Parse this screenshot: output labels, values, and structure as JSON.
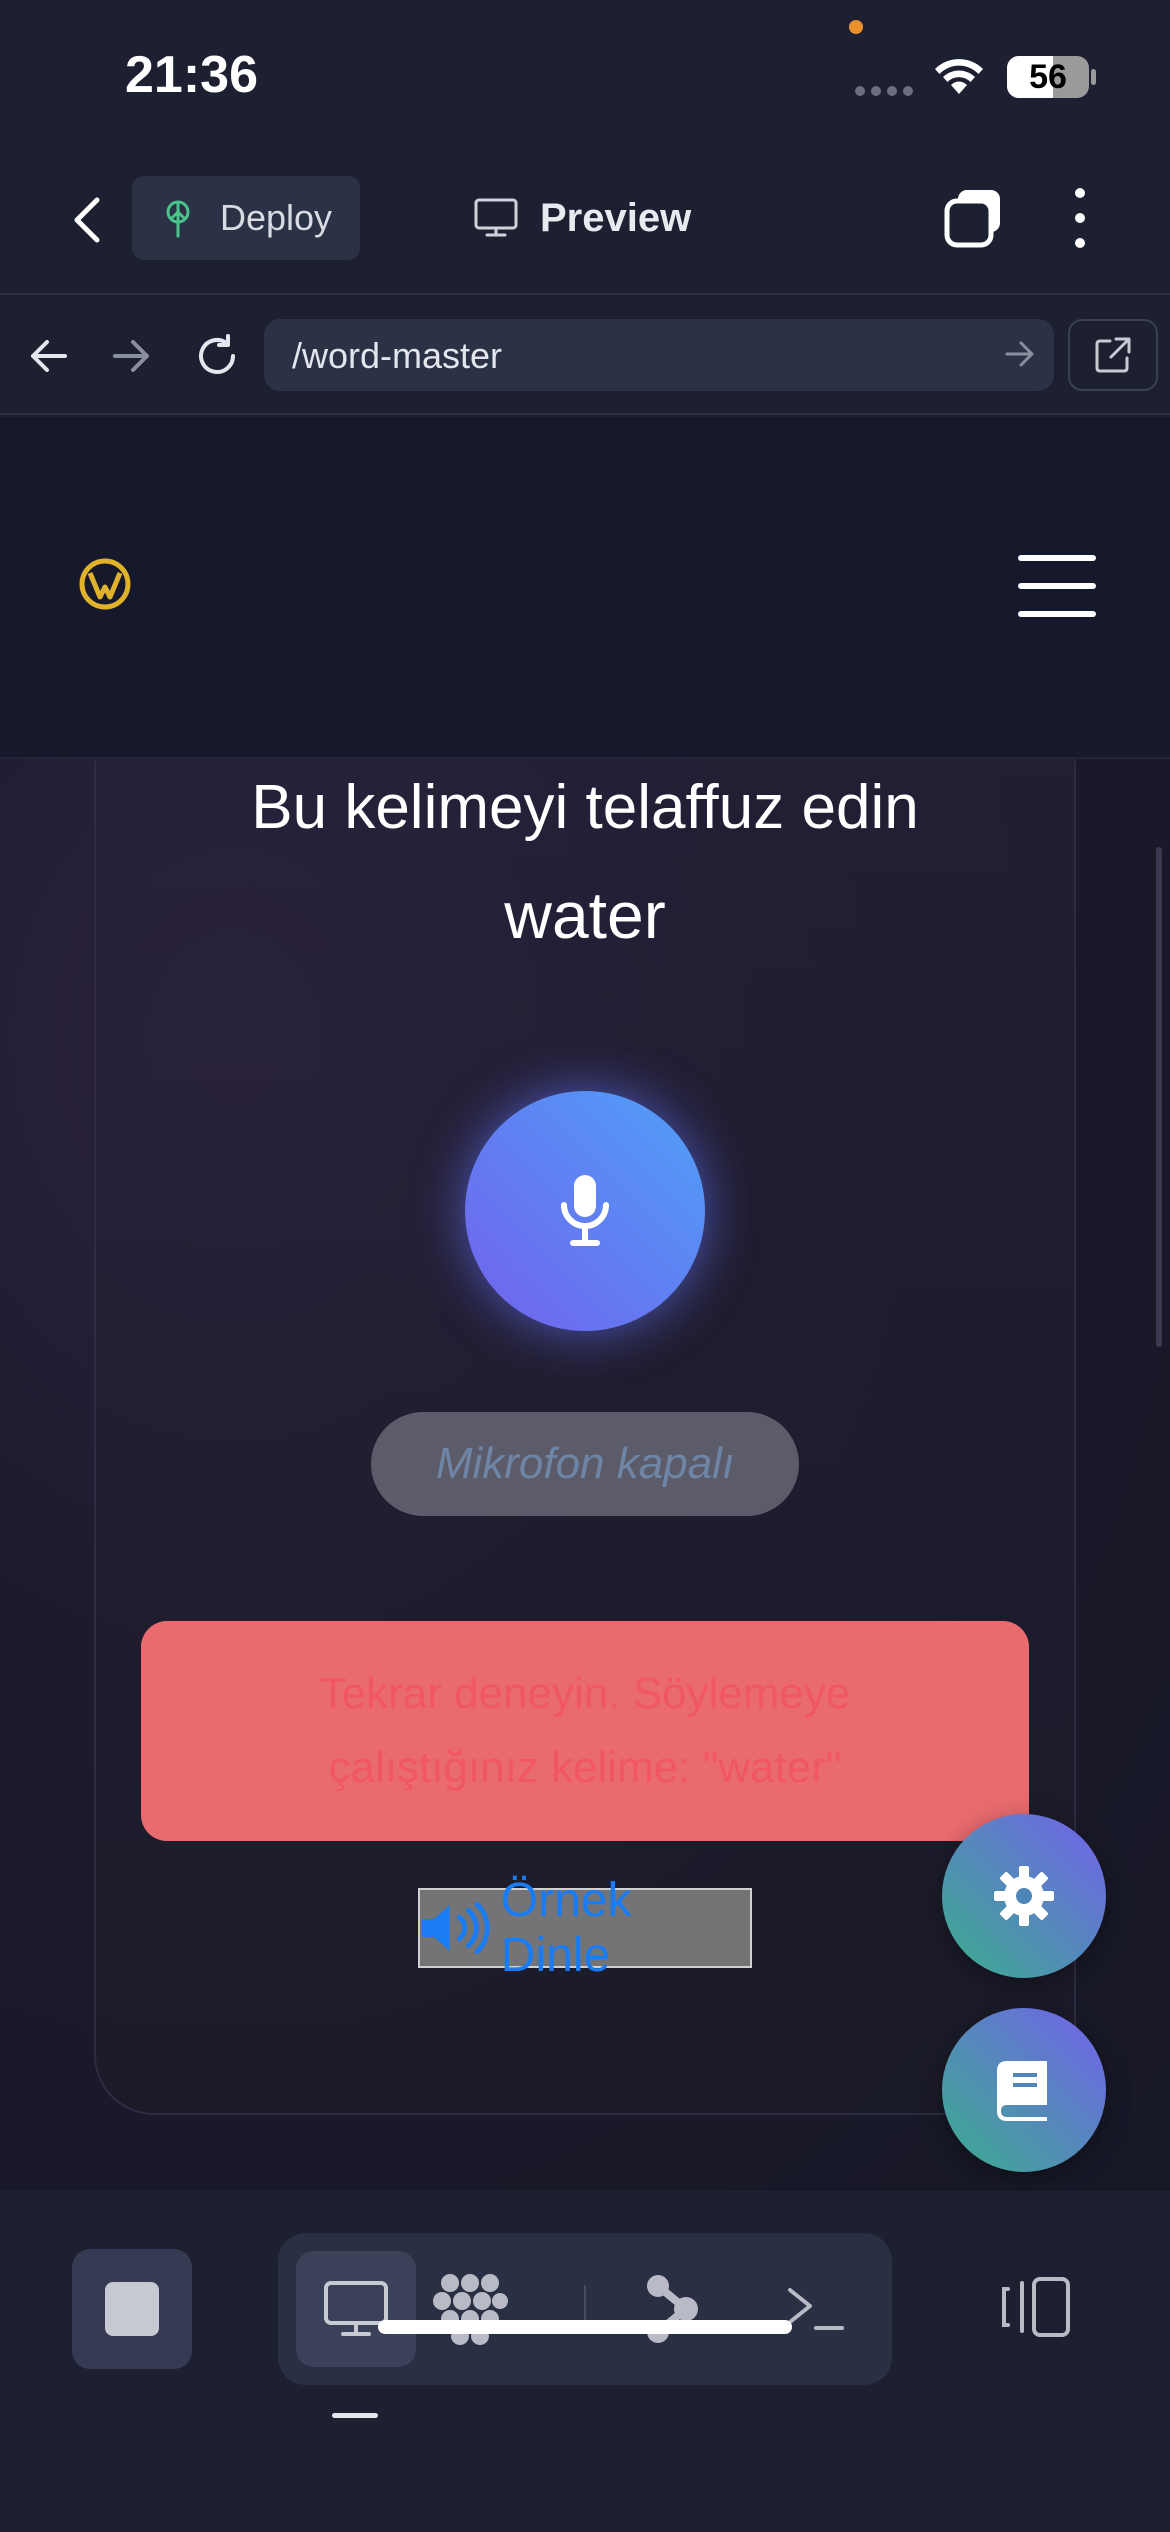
{
  "status": {
    "time": "21:36",
    "battery": "56",
    "battery_level": 0.56
  },
  "toolbar": {
    "deploy_label": "Deploy",
    "preview_label": "Preview"
  },
  "urlbar": {
    "url": "/word-master"
  },
  "content": {
    "prompt": "Bu kelimeyi telaffuz edin",
    "word": "water",
    "mic_status": "Mikrofon kapalı",
    "feedback": "Tekrar deneyin. Söylemeye çalıştığınız kelime: \"water\"",
    "listen_label": "Örnek Dinle"
  },
  "icons": {
    "back": "chevron-left-icon",
    "deploy": "deploy-tree-icon",
    "preview": "monitor-icon",
    "tabs": "tabs-icon",
    "more": "more-vertical-icon",
    "nav_back": "arrow-left-icon",
    "nav_forward": "arrow-right-icon",
    "reload": "reload-icon",
    "open_external": "external-link-icon",
    "logo": "logo-icon",
    "menu": "hamburger-icon",
    "mic": "microphone-icon",
    "speaker": "speaker-icon",
    "settings": "gear-icon",
    "book": "book-icon"
  },
  "colors": {
    "mic_gradient_start": "#7261ec",
    "mic_gradient_end": "#4fa0f8",
    "feedback_bg": "#e96b6e",
    "feedback_text": "#f05760",
    "listen_text": "#1a7cf5",
    "fab_gradient_start": "#3aae8c",
    "fab_gradient_end": "#7261ec",
    "logo_gold": "#e0b12a"
  }
}
